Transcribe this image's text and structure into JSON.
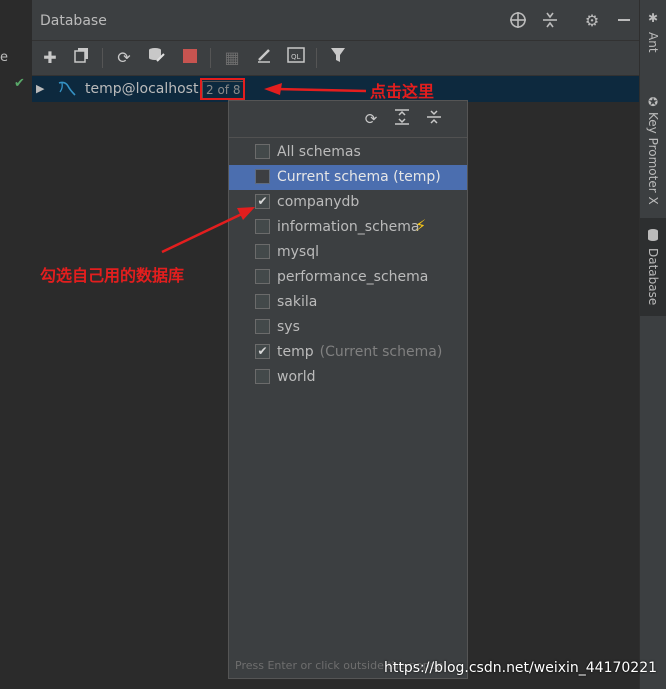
{
  "left_strip": {
    "partial_text": "e"
  },
  "panel": {
    "title": "Database"
  },
  "tree": {
    "connection_label": "temp@localhost",
    "schema_count_badge": "2 of 8"
  },
  "popup": {
    "items": [
      {
        "label": "All schemas",
        "checked": false,
        "selected": false,
        "note": ""
      },
      {
        "label": "Current schema (temp)",
        "checked": false,
        "selected": true,
        "note": ""
      },
      {
        "label": "companydb",
        "checked": true,
        "selected": false,
        "note": ""
      },
      {
        "label": "information_schema",
        "checked": false,
        "selected": false,
        "note": ""
      },
      {
        "label": "mysql",
        "checked": false,
        "selected": false,
        "note": ""
      },
      {
        "label": "performance_schema",
        "checked": false,
        "selected": false,
        "note": ""
      },
      {
        "label": "sakila",
        "checked": false,
        "selected": false,
        "note": ""
      },
      {
        "label": "sys",
        "checked": false,
        "selected": false,
        "note": ""
      },
      {
        "label": "temp",
        "checked": true,
        "selected": false,
        "note": "(Current schema)"
      },
      {
        "label": "world",
        "checked": false,
        "selected": false,
        "note": ""
      }
    ],
    "footer_hint": "Press Enter or click outside the popup"
  },
  "right_bar": {
    "tabs": [
      {
        "label": "Ant",
        "icon": "ant-icon"
      },
      {
        "label": "Key Promoter X",
        "icon": "key-promoter-icon"
      },
      {
        "label": "Database",
        "icon": "database-icon"
      }
    ]
  },
  "annotations": {
    "click_here": "点击这里",
    "select_your_db": "勾选自己用的数据库"
  },
  "watermark": "https://blog.csdn.net/weixin_44170221",
  "colors": {
    "panel_bg": "#3c3f41",
    "tree_bg": "#2b2b2b",
    "selection": "#4b6eaf",
    "annotation_red": "#e31e1e",
    "success_green": "#59a869",
    "bolt_yellow": "#f5c518"
  }
}
